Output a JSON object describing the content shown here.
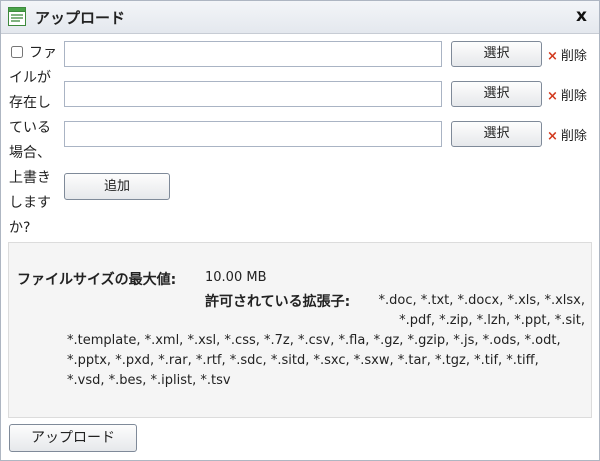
{
  "window": {
    "title": "アップロード",
    "close_label": "x"
  },
  "overwrite": {
    "label": "ファイルが存在している場合、上書きしますか?",
    "checked": false
  },
  "file_rows": [
    {
      "value": "",
      "select_label": "選択",
      "delete_label": "削除"
    },
    {
      "value": "",
      "select_label": "選択",
      "delete_label": "削除"
    },
    {
      "value": "",
      "select_label": "選択",
      "delete_label": "削除"
    }
  ],
  "add_label": "追加",
  "info": {
    "max_size_label": "ファイルサイズの最大値:",
    "max_size_value": "10.00 MB",
    "extensions_label": "許可されている拡張子:",
    "extensions_lines": [
      "*.doc, *.txt, *.docx, *.xls, *.xlsx,",
      "*.pdf, *.zip, *.lzh, *.ppt, *.sit,",
      "*.template, *.xml, *.xsl, *.css, *.7z, *.csv, *.fla, *.gz, *.gzip, *.js, *.ods, *.odt,",
      "*.pptx, *.pxd, *.rar, *.rtf, *.sdc, *.sitd, *.sxc, *.sxw, *.tar, *.tgz, *.tif, *.tiff,",
      "*.vsd, *.bes, *.iplist, *.tsv"
    ]
  },
  "upload_label": "アップロード",
  "colors": {
    "delete_x": "#d23a1e",
    "info_bg": "#f5f5f5",
    "titlebar": "#e9ecf1"
  },
  "icons": {
    "app": "form-document-icon",
    "delete": "x-icon"
  }
}
